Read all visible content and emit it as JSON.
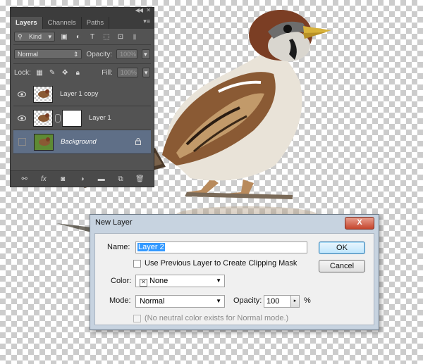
{
  "layers_panel": {
    "tabs": [
      "Layers",
      "Channels",
      "Paths"
    ],
    "filter_kind": "Kind",
    "blend_mode": "Normal",
    "opacity_label": "Opacity:",
    "opacity_value": "100%",
    "lock_label": "Lock:",
    "fill_label": "Fill:",
    "fill_value": "100%",
    "layers": [
      {
        "name": "Layer 1 copy",
        "visible": true
      },
      {
        "name": "Layer 1",
        "visible": true
      },
      {
        "name": "Background",
        "visible": false,
        "selected": true,
        "locked": true
      }
    ]
  },
  "dialog": {
    "title": "New Layer",
    "close_label": "X",
    "name_label": "Name:",
    "name_value": "Layer 2",
    "clipping_label": "Use Previous Layer to Create Clipping Mask",
    "color_label": "Color:",
    "color_value": "None",
    "mode_label": "Mode:",
    "mode_value": "Normal",
    "opacity_label": "Opacity:",
    "opacity_value": "100",
    "percent": "%",
    "neutral_label": "(No neutral color exists for Normal mode.)",
    "ok_label": "OK",
    "cancel_label": "Cancel"
  },
  "colors": {
    "panel_bg": "#535353",
    "selected_layer": "#5f6f87",
    "dialog_frame": "#c7d3e0",
    "name_highlight": "#3399ff"
  }
}
